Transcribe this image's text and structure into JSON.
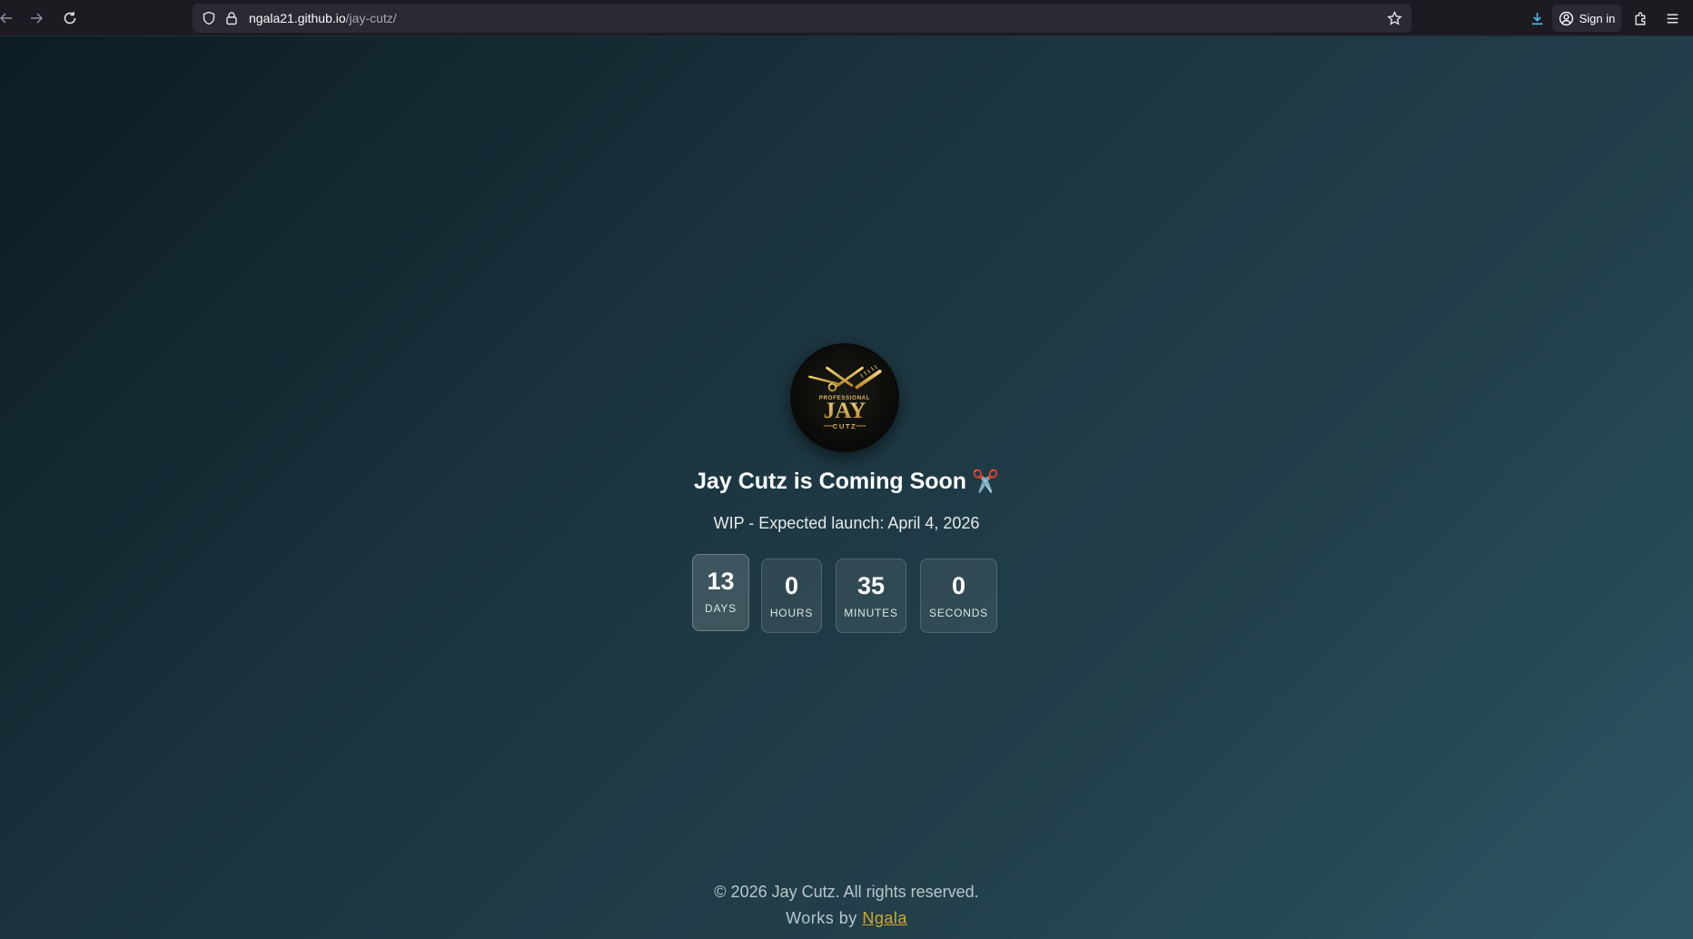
{
  "browser": {
    "url_host": "ngala21.github.io",
    "url_path": "/jay-cutz/",
    "signin_label": "Sign in"
  },
  "logo": {
    "top_text": "PROFESSIONAL",
    "main_text": "JAY",
    "bottom_text": "CUTZ"
  },
  "hero": {
    "title": "Jay Cutz is Coming Soon",
    "emoji": "✂️",
    "subtitle": "WIP - Expected launch: April 4, 2026"
  },
  "countdown": [
    {
      "value": "13",
      "label": "DAYS"
    },
    {
      "value": "0",
      "label": "HOURS"
    },
    {
      "value": "35",
      "label": "MINUTES"
    },
    {
      "value": "0",
      "label": "SECONDS"
    }
  ],
  "footer": {
    "copyright": "© 2026 Jay Cutz. All rights reserved.",
    "works_prefix": "Works by",
    "works_link": "Ngala"
  },
  "colors": {
    "accent_gold": "#d4a52c",
    "scissors_pink": "#f06a87"
  }
}
